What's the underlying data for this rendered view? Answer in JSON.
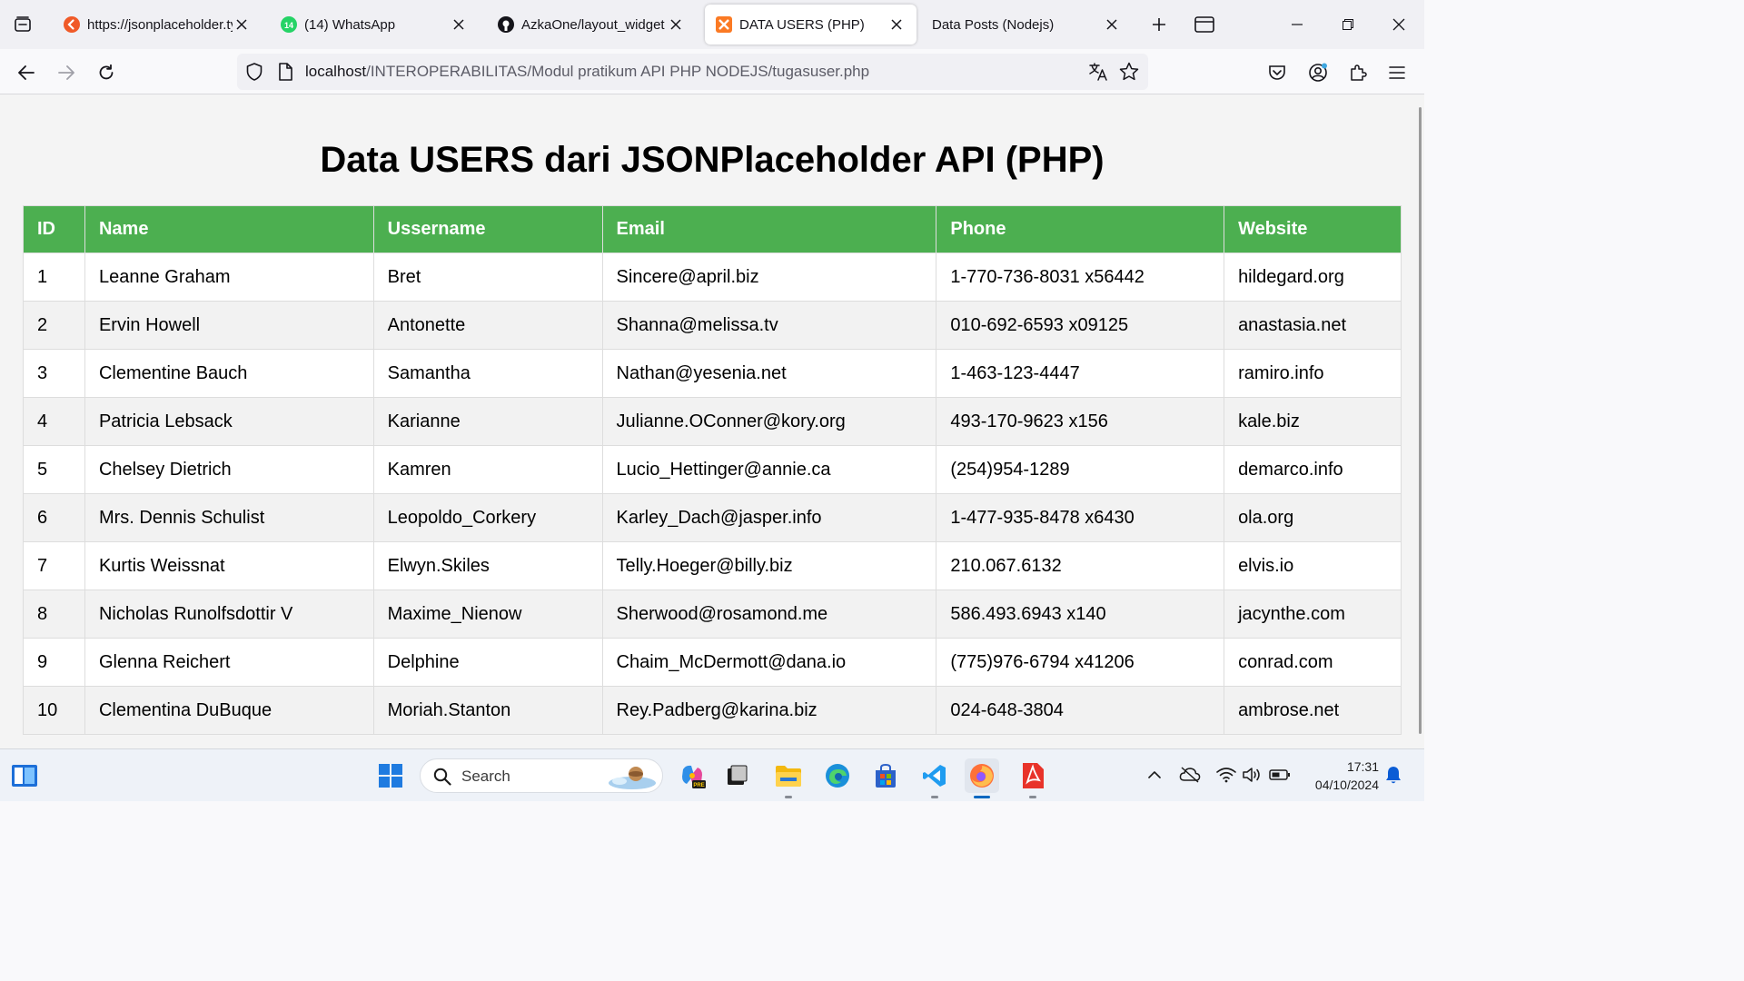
{
  "browser": {
    "tabs": [
      {
        "title": "https://jsonplaceholder.typicode.com/users",
        "favicon": "jsonplaceholder-icon",
        "active": false
      },
      {
        "title": "(14) WhatsApp",
        "favicon": "whatsapp-icon",
        "active": false
      },
      {
        "title": "AzkaOne/layout_widget",
        "favicon": "github-icon",
        "active": false
      },
      {
        "title": "DATA USERS (PHP)",
        "favicon": "xampp-icon",
        "active": true
      },
      {
        "title": "Data Posts (Nodejs)",
        "favicon": "",
        "active": false
      }
    ],
    "url_host": "localhost",
    "url_path": "/INTEROPERABILITAS/Modul pratikum API PHP NODEJS/tugasuser.php"
  },
  "page": {
    "heading": "Data USERS dari JSONPlaceholder API (PHP)",
    "columns": [
      "ID",
      "Name",
      "Ussername",
      "Email",
      "Phone",
      "Website"
    ],
    "rows": [
      [
        "1",
        "Leanne Graham",
        "Bret",
        "Sincere@april.biz",
        "1-770-736-8031 x56442",
        "hildegard.org"
      ],
      [
        "2",
        "Ervin Howell",
        "Antonette",
        "Shanna@melissa.tv",
        "010-692-6593 x09125",
        "anastasia.net"
      ],
      [
        "3",
        "Clementine Bauch",
        "Samantha",
        "Nathan@yesenia.net",
        "1-463-123-4447",
        "ramiro.info"
      ],
      [
        "4",
        "Patricia Lebsack",
        "Karianne",
        "Julianne.OConner@kory.org",
        "493-170-9623 x156",
        "kale.biz"
      ],
      [
        "5",
        "Chelsey Dietrich",
        "Kamren",
        "Lucio_Hettinger@annie.ca",
        "(254)954-1289",
        "demarco.info"
      ],
      [
        "6",
        "Mrs. Dennis Schulist",
        "Leopoldo_Corkery",
        "Karley_Dach@jasper.info",
        "1-477-935-8478 x6430",
        "ola.org"
      ],
      [
        "7",
        "Kurtis Weissnat",
        "Elwyn.Skiles",
        "Telly.Hoeger@billy.biz",
        "210.067.6132",
        "elvis.io"
      ],
      [
        "8",
        "Nicholas Runolfsdottir V",
        "Maxime_Nienow",
        "Sherwood@rosamond.me",
        "586.493.6943 x140",
        "jacynthe.com"
      ],
      [
        "9",
        "Glenna Reichert",
        "Delphine",
        "Chaim_McDermott@dana.io",
        "(775)976-6794 x41206",
        "conrad.com"
      ],
      [
        "10",
        "Clementina DuBuque",
        "Moriah.Stanton",
        "Rey.Padberg@karina.biz",
        "024-648-3804",
        "ambrose.net"
      ]
    ]
  },
  "taskbar": {
    "search_placeholder": "Search",
    "time": "17:31",
    "date": "04/10/2024",
    "whatsapp_badge": "14"
  },
  "colors": {
    "table_header": "#4caf50",
    "accent": "#0067c0"
  }
}
